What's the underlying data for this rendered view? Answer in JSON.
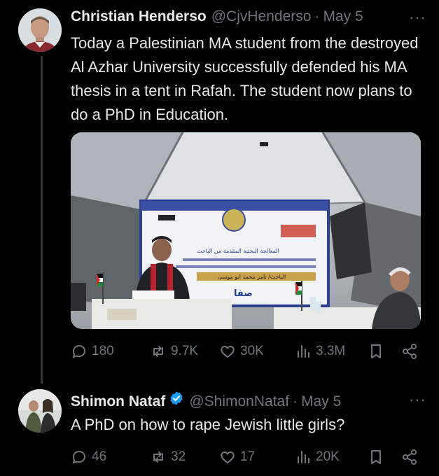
{
  "tweets": [
    {
      "author": "Christian Henderso",
      "handle": "@CjvHenderso",
      "separator": "·",
      "date": "May 5",
      "more": "···",
      "text": "Today a Palestinian MA student from the destroyed Al Azhar University successfully defended his MA thesis in a tent in Rafah. The student now plans to do a PhD in Education.",
      "media": {
        "banner_text": "المعالجة البحثية المقدمة من الباحث",
        "placard_name": "الباحث/ تامر محمد ابو موسى",
        "logo_text": "صفا"
      },
      "stats": {
        "replies": "180",
        "reposts": "9.7K",
        "likes": "30K",
        "views": "3.3M"
      }
    },
    {
      "author": "Shimon Nataf",
      "handle": "@ShimonNataf",
      "separator": "·",
      "date": "May 5",
      "more": "···",
      "text": "A PhD on how to rape Jewish little girls?",
      "verified": true,
      "stats": {
        "replies": "46",
        "reposts": "32",
        "likes": "17",
        "views": "20K"
      }
    }
  ],
  "colors": {
    "background": "#000000",
    "text": "#e7e9ea",
    "muted": "#71767b",
    "verified": "#1d9bf0",
    "thread_line": "#333639"
  }
}
